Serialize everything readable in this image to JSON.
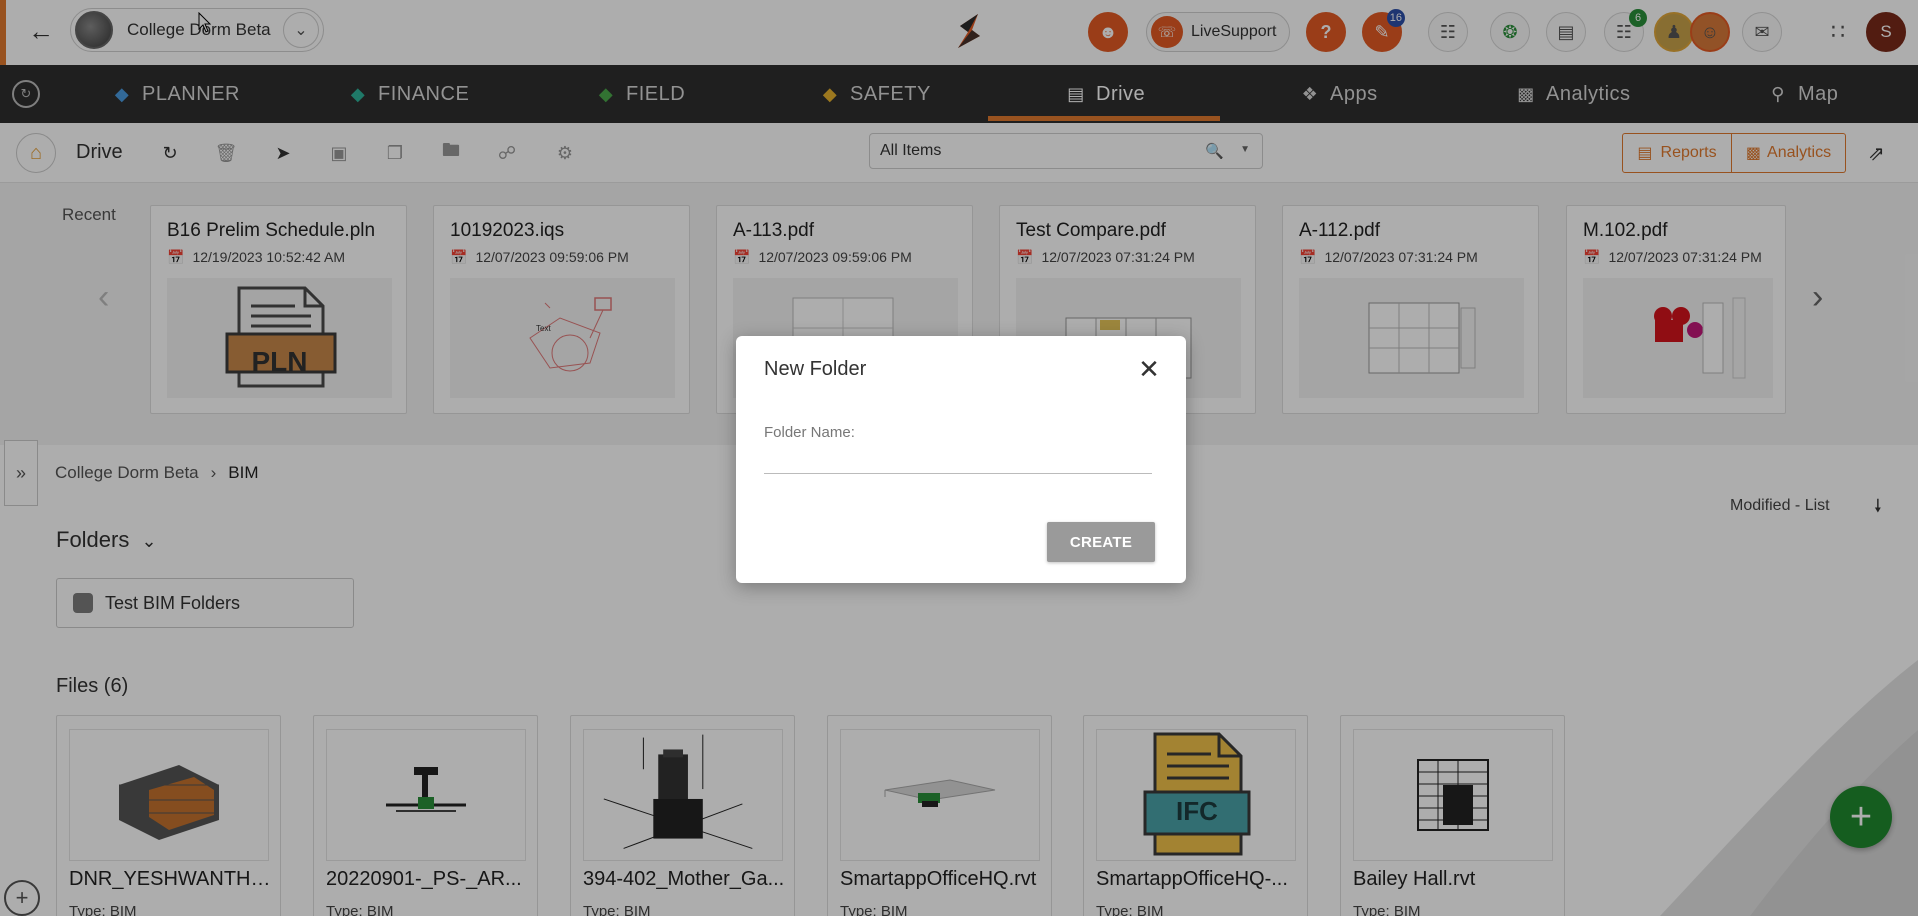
{
  "topbar": {
    "project_name": "College Dorm Beta",
    "live_support_label": "LiveSupport",
    "notifications_badge": "16",
    "cart_badge": "6",
    "user_initial": "S"
  },
  "nav": {
    "items": [
      {
        "label": "PLANNER",
        "icon": "planner-icon"
      },
      {
        "label": "FINANCE",
        "icon": "finance-icon"
      },
      {
        "label": "FIELD",
        "icon": "field-icon"
      },
      {
        "label": "SAFETY",
        "icon": "safety-icon"
      },
      {
        "label": "Drive",
        "icon": "drive-icon"
      },
      {
        "label": "Apps",
        "icon": "apps-icon"
      },
      {
        "label": "Analytics",
        "icon": "analytics-icon"
      },
      {
        "label": "Map",
        "icon": "map-icon"
      }
    ],
    "active": "Drive"
  },
  "toolbar": {
    "title": "Drive",
    "filter_value": "All Items",
    "reports_label": "Reports",
    "analytics_label": "Analytics"
  },
  "recent": {
    "label": "Recent",
    "items": [
      {
        "name": "B16 Prelim Schedule.pln",
        "date": "12/19/2023 10:52:42 AM"
      },
      {
        "name": "10192023.iqs",
        "date": "12/07/2023 09:59:06 PM"
      },
      {
        "name": "A-113.pdf",
        "date": "12/07/2023 09:59:06 PM"
      },
      {
        "name": "Test Compare.pdf",
        "date": "12/07/2023 07:31:24 PM"
      },
      {
        "name": "A-112.pdf",
        "date": "12/07/2023 07:31:24 PM"
      },
      {
        "name": "M.102.pdf",
        "date": "12/07/2023 07:31:24 PM"
      }
    ],
    "pln_label": "PLN",
    "text_label": "Text"
  },
  "breadcrumb": {
    "root": "College Dorm Beta",
    "current": "BIM"
  },
  "sort_label": "Modified - List",
  "folders": {
    "heading": "Folders",
    "items": [
      {
        "name": "Test BIM Folders"
      }
    ]
  },
  "files": {
    "heading": "Files (6)",
    "items": [
      {
        "name": "DNR_YESHWANTHP...",
        "type": "Type:  BIM"
      },
      {
        "name": "20220901-_PS-_AR...",
        "type": "Type:  BIM"
      },
      {
        "name": "394-402_Mother_Ga...",
        "type": "Type:  BIM"
      },
      {
        "name": "SmartappOfficeHQ.rvt",
        "type": "Type:  BIM"
      },
      {
        "name": "SmartappOfficeHQ-...",
        "type": "Type:  BIM"
      },
      {
        "name": "Bailey Hall.rvt",
        "type": "Type:  BIM"
      }
    ],
    "ifc_label": "IFC"
  },
  "modal": {
    "title": "New Folder",
    "field_label": "Folder Name:",
    "field_value": "",
    "create_label": "CREATE"
  },
  "colors": {
    "accent": "#e07a2e",
    "nav_bg": "#2f2f2f",
    "fab": "#1f8a2e"
  }
}
